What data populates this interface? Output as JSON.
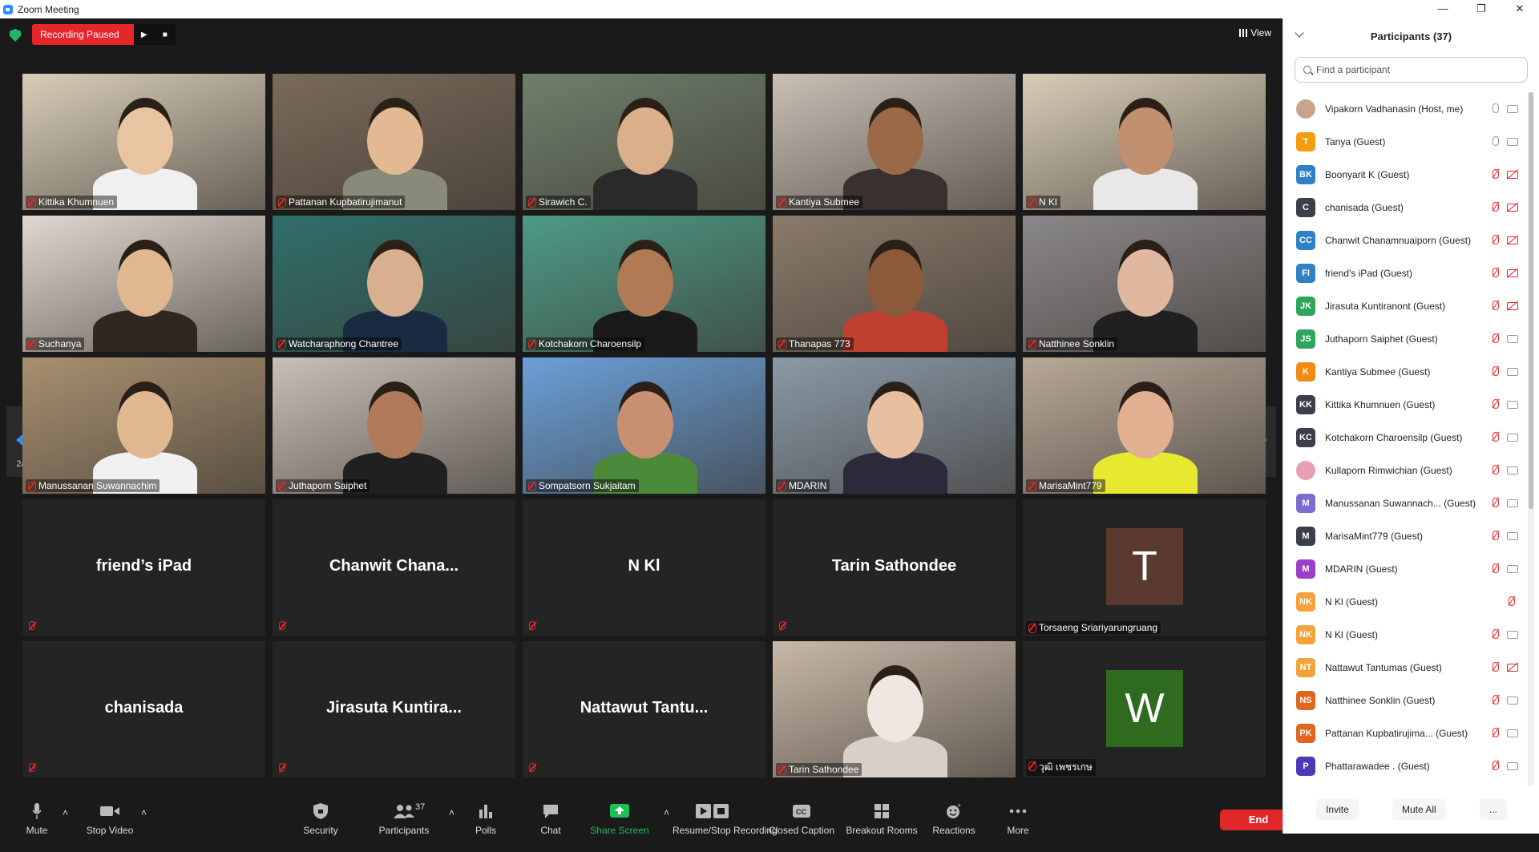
{
  "window": {
    "title": "Zoom Meeting"
  },
  "topbar": {
    "recording_label": "Recording Paused",
    "view_label": "View"
  },
  "nav": {
    "page_left": "2/2",
    "page_right": "2/2"
  },
  "tiles": [
    {
      "name": "Kittika Khumnuen",
      "type": "video",
      "bg": "#d8cdb8",
      "skin": "#e8c4a0",
      "shirt": "#f0f0f0"
    },
    {
      "name": "Pattanan Kupbatirujimanut",
      "type": "video",
      "bg": "#7a6a5a",
      "skin": "#e2b993",
      "shirt": "#8a8a7a"
    },
    {
      "name": "Sirawich C.",
      "type": "video",
      "bg": "#6f7f6b",
      "skin": "#d9b089",
      "shirt": "#2a2a2a"
    },
    {
      "name": "Kantiya Submee",
      "type": "video",
      "bg": "#c9bfb5",
      "skin": "#9a6a48",
      "shirt": "#3a3030"
    },
    {
      "name": "N Kl",
      "type": "video",
      "bg": "#d9cdb8",
      "skin": "#c09070",
      "shirt": "#e8e8e8"
    },
    {
      "name": "Suchanya",
      "type": "video",
      "bg": "#e0d8d0",
      "skin": "#e0b890",
      "shirt": "#302820"
    },
    {
      "name": "Watcharaphong Chantree",
      "type": "video",
      "bg": "#2f6f6a",
      "skin": "#d8b090",
      "shirt": "#1a2a40"
    },
    {
      "name": "Kotchakorn Charoensilp",
      "type": "video",
      "bg": "#4d9a86",
      "skin": "#b07a55",
      "shirt": "#1a1a1a"
    },
    {
      "name": "Thanapas 773",
      "type": "video",
      "bg": "#8a7a6a",
      "skin": "#8a5a3a",
      "shirt": "#c04030"
    },
    {
      "name": "Natthinee Sonklin",
      "type": "video",
      "bg": "#8a8888",
      "skin": "#e0b8a0",
      "shirt": "#202020"
    },
    {
      "name": "Manussanan Suwannachim",
      "type": "video",
      "bg": "#a89070",
      "skin": "#e0b890",
      "shirt": "#f0f0f0"
    },
    {
      "name": "Juthaporn Saiphet",
      "type": "video",
      "bg": "#c8c0b8",
      "skin": "#b07a5a",
      "shirt": "#202020"
    },
    {
      "name": "Sompatsorn Sukjaitam",
      "type": "video",
      "bg": "#6aa0d8",
      "skin": "#c89070",
      "shirt": "#4a8a3a"
    },
    {
      "name": "MDARIN",
      "type": "video",
      "bg": "#8a9aa8",
      "skin": "#e8c0a0",
      "shirt": "#2a2a3a"
    },
    {
      "name": "MarisaMint779",
      "type": "video",
      "bg": "#b8a898",
      "skin": "#e0b090",
      "shirt": "#e8e830"
    },
    {
      "name": "friend’s iPad",
      "type": "name",
      "label": "friend’s iPad"
    },
    {
      "name": "Chanwit Chanamnuaiporn",
      "type": "name",
      "label": "Chanwit  Chana..."
    },
    {
      "name": "N Kl",
      "type": "name",
      "label": "N Kl"
    },
    {
      "name": "Tarin Sathondee",
      "type": "name",
      "label": "Tarin Sathondee"
    },
    {
      "name": "Torsaeng Sriariyarungruang",
      "type": "avatar",
      "letter": "T",
      "color": "#5a3a30"
    },
    {
      "name": "chanisada",
      "type": "name",
      "label": "chanisada"
    },
    {
      "name": "Jirasuta Kuntiranont",
      "type": "name",
      "label": "Jirasuta  Kuntira..."
    },
    {
      "name": "Nattawut Tantumas",
      "type": "name",
      "label": "Nattawut  Tantu..."
    },
    {
      "name": "Tarin Sathondee",
      "type": "video",
      "bg": "#c8b8a8",
      "skin": "#f0e8e0",
      "shirt": "#d8d0c8"
    },
    {
      "name": "วุฒิ เพชรเกษ",
      "type": "avatar",
      "letter": "W",
      "color": "#2e6b1f"
    }
  ],
  "toolbar": {
    "items": [
      {
        "label": "Mute",
        "icon": "microphone-icon"
      },
      {
        "label": "Stop Video",
        "icon": "video-camera-icon"
      },
      {
        "label": "Security",
        "icon": "shield-icon"
      },
      {
        "label": "Participants",
        "icon": "participants-icon",
        "count": "37"
      },
      {
        "label": "Polls",
        "icon": "polls-icon"
      },
      {
        "label": "Chat",
        "icon": "chat-icon"
      },
      {
        "label": "Share Screen",
        "icon": "share-screen-icon"
      },
      {
        "label": "Resume/Stop Recording",
        "icon": "recording-icon"
      },
      {
        "label": "Closed Caption",
        "icon": "cc-icon"
      },
      {
        "label": "Breakout Rooms",
        "icon": "breakout-rooms-icon"
      },
      {
        "label": "Reactions",
        "icon": "reactions-icon"
      },
      {
        "label": "More",
        "icon": "more-icon"
      }
    ],
    "end_label": "End"
  },
  "panel": {
    "title": "Participants (37)",
    "search_placeholder": "Find a participant",
    "invite_label": "Invite",
    "mute_all_label": "Mute All",
    "more_label": "...",
    "participants": [
      {
        "name": "Vipakorn Vadhanasin (Host, me)",
        "initials": "",
        "color": "#c7a48a",
        "mic": "on",
        "cam": "on"
      },
      {
        "name": "Tanya (Guest)",
        "initials": "T",
        "color": "#f39c12",
        "mic": "on",
        "cam": "on"
      },
      {
        "name": "Boonyarit K (Guest)",
        "initials": "BK",
        "color": "#2f80c4",
        "mic": "muted",
        "cam": "muted"
      },
      {
        "name": "chanisada (Guest)",
        "initials": "C",
        "color": "#3a3f4a",
        "mic": "muted",
        "cam": "muted"
      },
      {
        "name": "Chanwit Chanamnuaiporn (Guest)",
        "initials": "CC",
        "color": "#2f80c4",
        "mic": "muted",
        "cam": "muted"
      },
      {
        "name": "friend's iPad (Guest)",
        "initials": "FI",
        "color": "#2f80c4",
        "mic": "muted",
        "cam": "muted"
      },
      {
        "name": "Jirasuta Kuntiranont (Guest)",
        "initials": "JK",
        "color": "#2ea55a",
        "mic": "muted",
        "cam": "muted"
      },
      {
        "name": "Juthaporn Saiphet (Guest)",
        "initials": "JS",
        "color": "#2ea55a",
        "mic": "muted",
        "cam": "on"
      },
      {
        "name": "Kantiya Submee (Guest)",
        "initials": "K",
        "color": "#f08a10",
        "mic": "muted",
        "cam": "on"
      },
      {
        "name": "Kittika Khumnuen (Guest)",
        "initials": "KK",
        "color": "#3a3f4a",
        "mic": "muted",
        "cam": "on"
      },
      {
        "name": "Kotchakorn Charoensilp (Guest)",
        "initials": "KC",
        "color": "#3a3f4a",
        "mic": "muted",
        "cam": "on"
      },
      {
        "name": "Kullaporn Rimwichian (Guest)",
        "initials": "",
        "color": "#e8a0b0",
        "mic": "muted",
        "cam": "on"
      },
      {
        "name": "Manussanan Suwannach... (Guest)",
        "initials": "M",
        "color": "#7c6bd0",
        "mic": "muted",
        "cam": "on"
      },
      {
        "name": "MarisaMint779 (Guest)",
        "initials": "M",
        "color": "#3a3f4a",
        "mic": "muted",
        "cam": "on"
      },
      {
        "name": "MDARIN (Guest)",
        "initials": "M",
        "color": "#9b3fc9",
        "mic": "muted",
        "cam": "on"
      },
      {
        "name": "N Kl (Guest)",
        "initials": "NK",
        "color": "#f2a33a",
        "mic": "muted",
        "cam": "none"
      },
      {
        "name": "N Kl (Guest)",
        "initials": "NK",
        "color": "#f2a33a",
        "mic": "muted",
        "cam": "on"
      },
      {
        "name": "Nattawut Tantumas (Guest)",
        "initials": "NT",
        "color": "#f2a33a",
        "mic": "muted",
        "cam": "muted"
      },
      {
        "name": "Natthinee Sonklin (Guest)",
        "initials": "NS",
        "color": "#e0651f",
        "mic": "muted",
        "cam": "on"
      },
      {
        "name": "Pattanan Kupbatirujima... (Guest)",
        "initials": "PK",
        "color": "#e0651f",
        "mic": "muted",
        "cam": "on"
      },
      {
        "name": "Phattarawadee . (Guest)",
        "initials": "P",
        "color": "#4a3ab8",
        "mic": "muted",
        "cam": "on"
      }
    ]
  }
}
